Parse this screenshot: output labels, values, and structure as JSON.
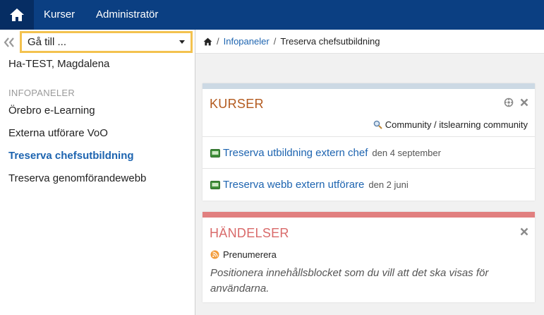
{
  "colors": {
    "topbar": "#0b3f82",
    "home_bg": "#062d63",
    "link": "#1d64b0",
    "kurser_title": "#b35a1e",
    "kurser_strip": "#ccd9e4",
    "handelser_title": "#d96a6a",
    "handelser_strip": "#e17f7f",
    "goto_border": "#f3c24f"
  },
  "topbar": {
    "home_icon": "home-icon",
    "nav": [
      "Kurser",
      "Administratör"
    ]
  },
  "sidebar": {
    "goto_placeholder": "Gå till ...",
    "user": "Ha-TEST, Magdalena",
    "section": "INFOPANELER",
    "items": [
      {
        "label": "Örebro e-Learning",
        "active": false
      },
      {
        "label": "Externa utförare VoO",
        "active": false
      },
      {
        "label": "Treserva chefsutbildning",
        "active": true
      },
      {
        "label": "Treserva genomförandewebb",
        "active": false
      }
    ]
  },
  "breadcrumb": {
    "link": "Infopaneler",
    "current": "Treserva chefsutbildning"
  },
  "kurser_panel": {
    "title": "KURSER",
    "community": "Community / itslearning community",
    "courses": [
      {
        "name": "Treserva utbildning extern chef",
        "date": "den 4 september"
      },
      {
        "name": "Treserva webb extern utförare",
        "date": "den 2 juni"
      }
    ]
  },
  "handelser_panel": {
    "title": "HÄNDELSER",
    "subscribe": "Prenumerera",
    "hint": "Positionera innehållsblocket som du vill att det ska visas för användarna."
  }
}
